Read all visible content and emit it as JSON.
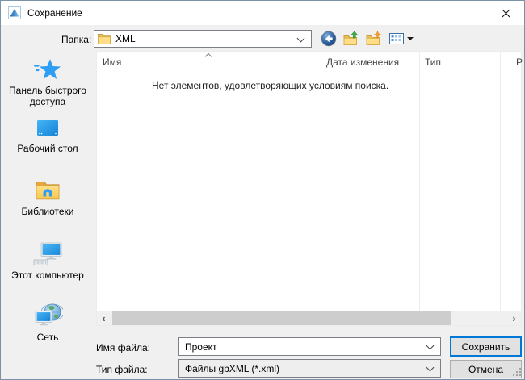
{
  "window": {
    "title": "Сохранение"
  },
  "toolbar": {
    "folder_label": "Папка:",
    "folder_value": "XML",
    "icon_names": [
      "back-icon",
      "up-one-level-icon",
      "new-folder-icon",
      "view-menu-icon"
    ]
  },
  "sidebar": {
    "items": [
      {
        "label": "Панель быстрого доступа",
        "icon": "quick-access-icon"
      },
      {
        "label": "Рабочий стол",
        "icon": "desktop-icon"
      },
      {
        "label": "Библиотеки",
        "icon": "libraries-icon"
      },
      {
        "label": "Этот компьютер",
        "icon": "this-pc-icon"
      },
      {
        "label": "Сеть",
        "icon": "network-icon"
      }
    ]
  },
  "list": {
    "columns": [
      {
        "label": "Имя",
        "sorted": "ascending"
      },
      {
        "label": "Дата изменения"
      },
      {
        "label": "Тип"
      },
      {
        "label": "Р"
      }
    ],
    "empty_message": "Нет элементов, удовлетворяющих условиям поиска."
  },
  "hscrollbar": {
    "left_arrow": "‹",
    "right_arrow": "›"
  },
  "form": {
    "filename_label": "Имя файла:",
    "filename_value": "Проект",
    "filetype_label": "Тип файла:",
    "filetype_value": "Файлы gbXML (*.xml)"
  },
  "buttons": {
    "save": "Сохранить",
    "cancel": "Отмена"
  },
  "colors": {
    "accent": "#0078d7",
    "dialog_bg": "#f0f0f0",
    "window_border": "#7b91a5",
    "scrollbar_thumb": "#cdcdcd"
  }
}
